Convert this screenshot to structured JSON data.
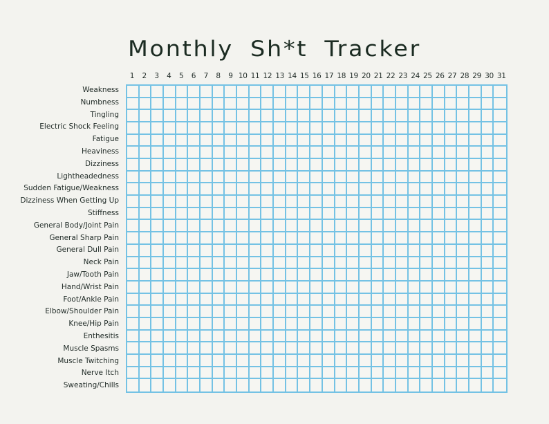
{
  "title": "Monthly Sh*t Tracker",
  "days": [
    "1",
    "2",
    "3",
    "4",
    "5",
    "6",
    "7",
    "8",
    "9",
    "10",
    "11",
    "12",
    "13",
    "14",
    "15",
    "16",
    "17",
    "18",
    "19",
    "20",
    "21",
    "22",
    "23",
    "24",
    "25",
    "26",
    "27",
    "28",
    "29",
    "30",
    "31"
  ],
  "symptoms": [
    "Weakness",
    "Numbness",
    "Tingling",
    "Electric Shock Feeling",
    "Fatigue",
    "Heaviness",
    "Dizziness",
    "Lightheadedness",
    "Sudden Fatigue/Weakness",
    "Dizziness When Getting Up",
    "Stiffness",
    "General Body/Joint Pain",
    "General Sharp Pain",
    "General Dull Pain",
    "Neck Pain",
    "Jaw/Tooth Pain",
    "Hand/Wrist Pain",
    "Foot/Ankle Pain",
    "Elbow/Shoulder Pain",
    "Knee/Hip Pain",
    "Enthesitis",
    "Muscle Spasms",
    "Muscle Twitching",
    "Nerve Itch",
    "Sweating/Chills"
  ],
  "colors": {
    "background": "#f3f3ef",
    "grid_line": "#74c2e4",
    "text": "#1f2a26"
  }
}
